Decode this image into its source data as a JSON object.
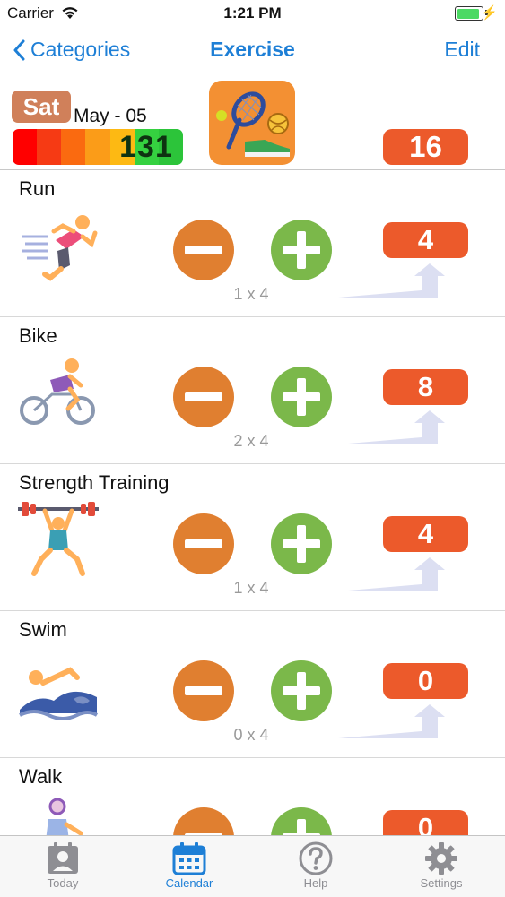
{
  "status": {
    "carrier": "Carrier",
    "time": "1:21 PM",
    "battery_level": 0.92
  },
  "nav": {
    "back_label": "Categories",
    "title": "Exercise",
    "edit_label": "Edit"
  },
  "header": {
    "day": "Sat",
    "date": "May - 05",
    "heat_value": "131",
    "heat_colors": [
      "#ff0000",
      "#f63a14",
      "#fa6a10",
      "#fb9c18",
      "#fdb913",
      "#35d140",
      "#2cc43a"
    ],
    "total": "16"
  },
  "rows": [
    {
      "title": "Run",
      "formula": "1 x 4",
      "count": "4",
      "icon": "running-icon"
    },
    {
      "title": "Bike",
      "formula": "2 x 4",
      "count": "8",
      "icon": "cycling-icon"
    },
    {
      "title": "Strength Training",
      "formula": "1 x 4",
      "count": "4",
      "icon": "weightlifting-icon"
    },
    {
      "title": "Swim",
      "formula": "0 x 4",
      "count": "0",
      "icon": "swimming-icon"
    },
    {
      "title": "Walk",
      "formula": "",
      "count": "0",
      "icon": "walking-icon"
    }
  ],
  "tabs": [
    {
      "label": "Today",
      "icon": "today-icon",
      "active": false
    },
    {
      "label": "Calendar",
      "icon": "calendar-icon",
      "active": true
    },
    {
      "label": "Help",
      "icon": "help-icon",
      "active": false
    },
    {
      "label": "Settings",
      "icon": "gear-icon",
      "active": false
    }
  ],
  "colors": {
    "accent": "#1e7fd6",
    "badge": "#ec5a2b",
    "minus": "#e07f30",
    "plus": "#7bb84a",
    "category_icon_bg": "#f39033"
  }
}
